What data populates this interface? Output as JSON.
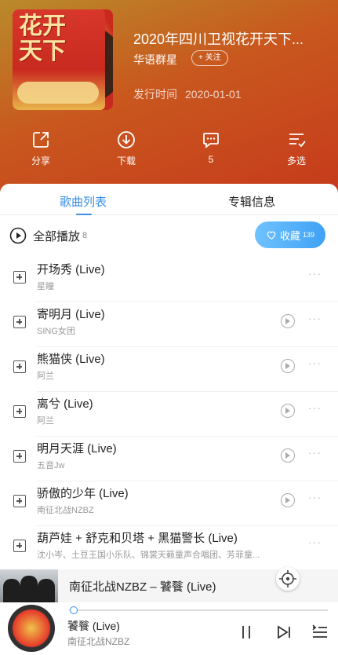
{
  "album": {
    "title": "2020年四川卫视花开天下...",
    "artist": "华语群星",
    "follow_label": "+ 关注",
    "release_label": "发行时间",
    "release_date": "2020-01-01",
    "cover_text": "花开天下"
  },
  "actions": [
    {
      "label": "分享",
      "icon": "share-icon"
    },
    {
      "label": "下载",
      "icon": "download-icon"
    },
    {
      "label": "5",
      "icon": "comment-icon"
    },
    {
      "label": "多选",
      "icon": "multi-select-icon"
    }
  ],
  "tabs": [
    {
      "label": "歌曲列表",
      "active": true
    },
    {
      "label": "专辑信息",
      "active": false
    }
  ],
  "playall": {
    "label": "全部播放",
    "count": "8"
  },
  "collect": {
    "label": "收藏",
    "count": "139"
  },
  "songs": [
    {
      "name": "开场秀 (Live)",
      "artist": "星瞳",
      "mv": false
    },
    {
      "name": "寄明月 (Live)",
      "artist": "SING女团",
      "mv": true
    },
    {
      "name": "熊猫侠 (Live)",
      "artist": "阿兰",
      "mv": true
    },
    {
      "name": "离兮 (Live)",
      "artist": "阿兰",
      "mv": true
    },
    {
      "name": "明月天涯 (Live)",
      "artist": "五音Jw",
      "mv": true
    },
    {
      "name": "骄傲的少年 (Live)",
      "artist": "南征北战NZBZ",
      "mv": true
    },
    {
      "name": "葫芦娃 + 舒克和贝塔 + 黑猫警长 (Live)",
      "artist": "沈小岑、土豆王国小乐队、锦裳天籁童声合唱团、芳菲童...",
      "mv": false
    }
  ],
  "banner": {
    "text": "南征北战NZBZ – 饕餮 (Live)"
  },
  "player": {
    "title": "饕餮 (Live)",
    "artist": "南征北战NZBZ",
    "progress": 0.01
  },
  "colors": {
    "accent": "#3a8ee6",
    "header_red": "#c63a1c"
  }
}
